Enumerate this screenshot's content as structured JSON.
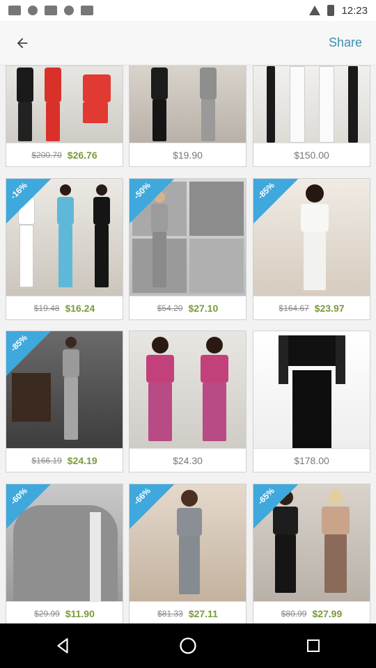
{
  "status_bar": {
    "time": "12:23"
  },
  "appbar": {
    "share_label": "Share"
  },
  "products": [
    {
      "discount": "",
      "old_price": "$200.70",
      "price": "$26.76"
    },
    {
      "discount": "",
      "old_price": "",
      "price": "$19.90"
    },
    {
      "discount": "",
      "old_price": "",
      "price": "$150.00"
    },
    {
      "discount": "-16%",
      "old_price": "$19.48",
      "price": "$16.24"
    },
    {
      "discount": "-50%",
      "old_price": "$54.20",
      "price": "$27.10"
    },
    {
      "discount": "-85%",
      "old_price": "$164.67",
      "price": "$23.97"
    },
    {
      "discount": "-85%",
      "old_price": "$166.19",
      "price": "$24.19"
    },
    {
      "discount": "",
      "old_price": "",
      "price": "$24.30"
    },
    {
      "discount": "",
      "old_price": "",
      "price": "$178.00"
    },
    {
      "discount": "-60%",
      "old_price": "$29.99",
      "price": "$11.90"
    },
    {
      "discount": "-66%",
      "old_price": "$81.33",
      "price": "$27.11"
    },
    {
      "discount": "-65%",
      "old_price": "$80.99",
      "price": "$27.99"
    }
  ],
  "colors": {
    "accent": "#3c8eae",
    "badge": "#3fa8dc",
    "sale_price": "#7a9a3a"
  },
  "icons": {
    "back": "arrow-left-icon",
    "nav_back": "triangle-back-icon",
    "nav_home": "circle-home-icon",
    "nav_recents": "square-recents-icon"
  }
}
